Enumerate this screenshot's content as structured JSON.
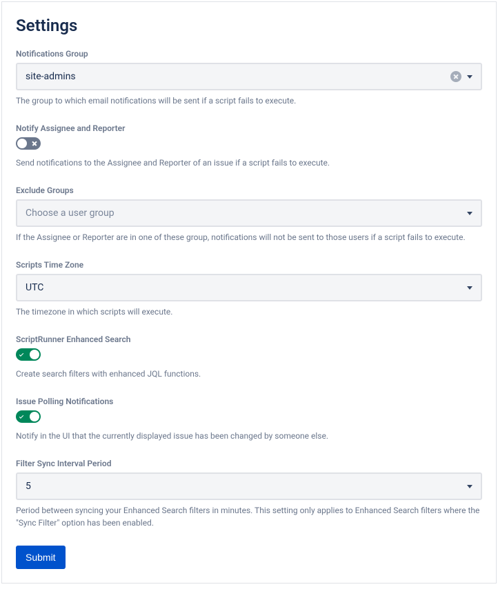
{
  "page_title": "Settings",
  "notifications_group": {
    "label": "Notifications Group",
    "value": "site-admins",
    "help": "The group to which email notifications will be sent if a script fails to execute."
  },
  "notify_assignee": {
    "label": "Notify Assignee and Reporter",
    "state": "off",
    "help": "Send notifications to the Assignee and Reporter of an issue if a script fails to execute."
  },
  "exclude_groups": {
    "label": "Exclude Groups",
    "placeholder": "Choose a user group",
    "help": "If the Assignee or Reporter are in one of these group, notifications will not be sent to those users if a script fails to execute."
  },
  "scripts_timezone": {
    "label": "Scripts Time Zone",
    "value": "UTC",
    "help": "The timezone in which scripts will execute."
  },
  "enhanced_search": {
    "label": "ScriptRunner Enhanced Search",
    "state": "on",
    "help": "Create search filters with enhanced JQL functions."
  },
  "issue_polling": {
    "label": "Issue Polling Notifications",
    "state": "on",
    "help": "Notify in the UI that the currently displayed issue has been changed by someone else."
  },
  "filter_sync": {
    "label": "Filter Sync Interval Period",
    "value": "5",
    "help": "Period between syncing your Enhanced Search filters in minutes. This setting only applies to Enhanced Search filters where the \"Sync Filter\" option has been enabled."
  },
  "submit_label": "Submit"
}
